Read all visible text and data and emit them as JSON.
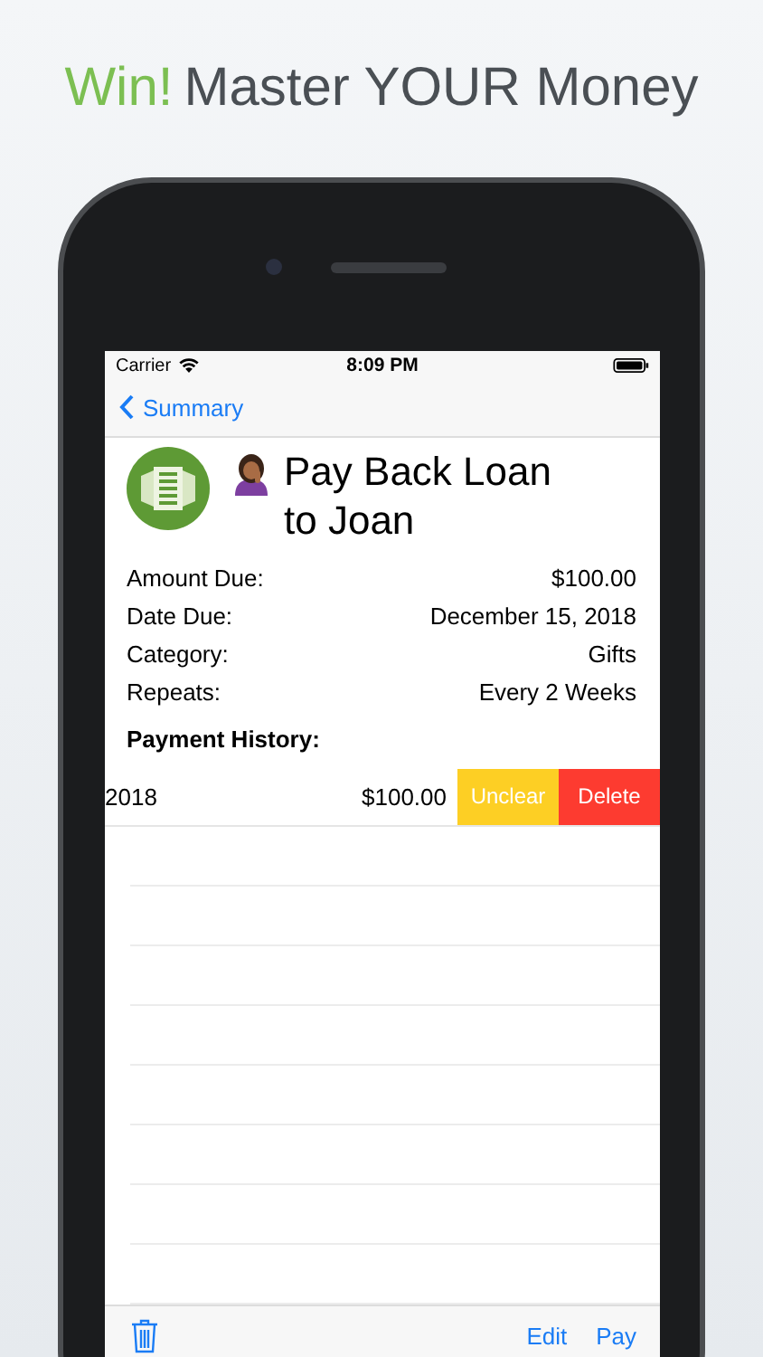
{
  "headline": {
    "accent": "Win!",
    "text": "Master YOUR Money"
  },
  "status_bar": {
    "carrier": "Carrier",
    "time": "8:09 PM"
  },
  "nav": {
    "back": "Summary"
  },
  "bill": {
    "title": "Pay Back Loan to Joan",
    "fields": [
      {
        "label": "Amount Due:",
        "value": "$100.00"
      },
      {
        "label": "Date Due:",
        "value": "December 15, 2018"
      },
      {
        "label": "Category:",
        "value": "Gifts"
      },
      {
        "label": "Repeats:",
        "value": "Every 2 Weeks"
      }
    ]
  },
  "history": {
    "heading": "Payment History:",
    "rows": [
      {
        "date": "2018",
        "amount": "$100.00",
        "actions": [
          {
            "label": "Unclear",
            "kind": "warn"
          },
          {
            "label": "Delete",
            "kind": "destructive"
          }
        ]
      }
    ]
  },
  "toolbar": {
    "buttons": [
      "Edit",
      "Pay"
    ]
  }
}
